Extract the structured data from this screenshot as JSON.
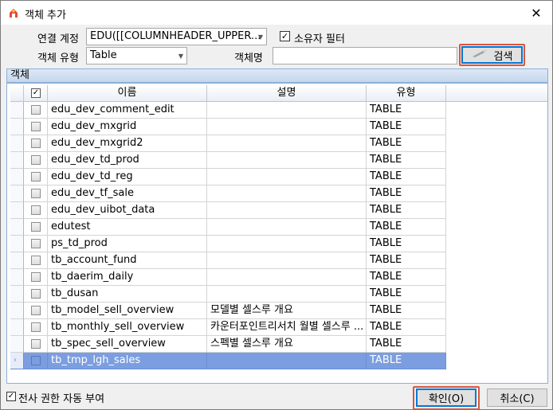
{
  "window": {
    "title": "객체 추가",
    "close_glyph": "✕"
  },
  "form": {
    "connection_label": "연결 계정",
    "connection_value": "EDU([[COLUMNHEADER_UPPER...",
    "owner_filter_label": "소유자 필터",
    "owner_filter_checked": true,
    "object_type_label": "객체 유형",
    "object_type_value": "Table",
    "object_name_label": "객체명",
    "object_name_value": "",
    "search_button": "검색"
  },
  "group": {
    "title": "객체"
  },
  "grid": {
    "columns": {
      "name": "이름",
      "description": "설명",
      "type": "유형"
    },
    "rows": [
      {
        "name": "edu_dev_comment_edit",
        "description": "",
        "type": "TABLE"
      },
      {
        "name": "edu_dev_mxgrid",
        "description": "",
        "type": "TABLE"
      },
      {
        "name": "edu_dev_mxgrid2",
        "description": "",
        "type": "TABLE"
      },
      {
        "name": "edu_dev_td_prod",
        "description": "",
        "type": "TABLE"
      },
      {
        "name": "edu_dev_td_reg",
        "description": "",
        "type": "TABLE"
      },
      {
        "name": "edu_dev_tf_sale",
        "description": "",
        "type": "TABLE"
      },
      {
        "name": "edu_dev_uibot_data",
        "description": "",
        "type": "TABLE"
      },
      {
        "name": "edutest",
        "description": "",
        "type": "TABLE"
      },
      {
        "name": "ps_td_prod",
        "description": "",
        "type": "TABLE"
      },
      {
        "name": "tb_account_fund",
        "description": "",
        "type": "TABLE"
      },
      {
        "name": "tb_daerim_daily",
        "description": "",
        "type": "TABLE"
      },
      {
        "name": "tb_dusan",
        "description": "",
        "type": "TABLE"
      },
      {
        "name": "tb_model_sell_overview",
        "description": "모델별 셀스루 개요",
        "type": "TABLE"
      },
      {
        "name": "tb_monthly_sell_overview",
        "description": "카운터포인트리서치 월별 셀스루 ...",
        "type": "TABLE"
      },
      {
        "name": "tb_spec_sell_overview",
        "description": "스펙별 셀스루 개요",
        "type": "TABLE"
      },
      {
        "name": "tb_tmp_lgh_sales",
        "description": "",
        "type": "TABLE"
      }
    ]
  },
  "footer": {
    "auto_grant_label": "전사 권한 자동 부여",
    "auto_grant_checked": true,
    "ok_button": "확인(O)",
    "cancel_button": "취소(C)"
  },
  "colors": {
    "accent": "#d9573b",
    "selection": "#7b9ee0"
  }
}
